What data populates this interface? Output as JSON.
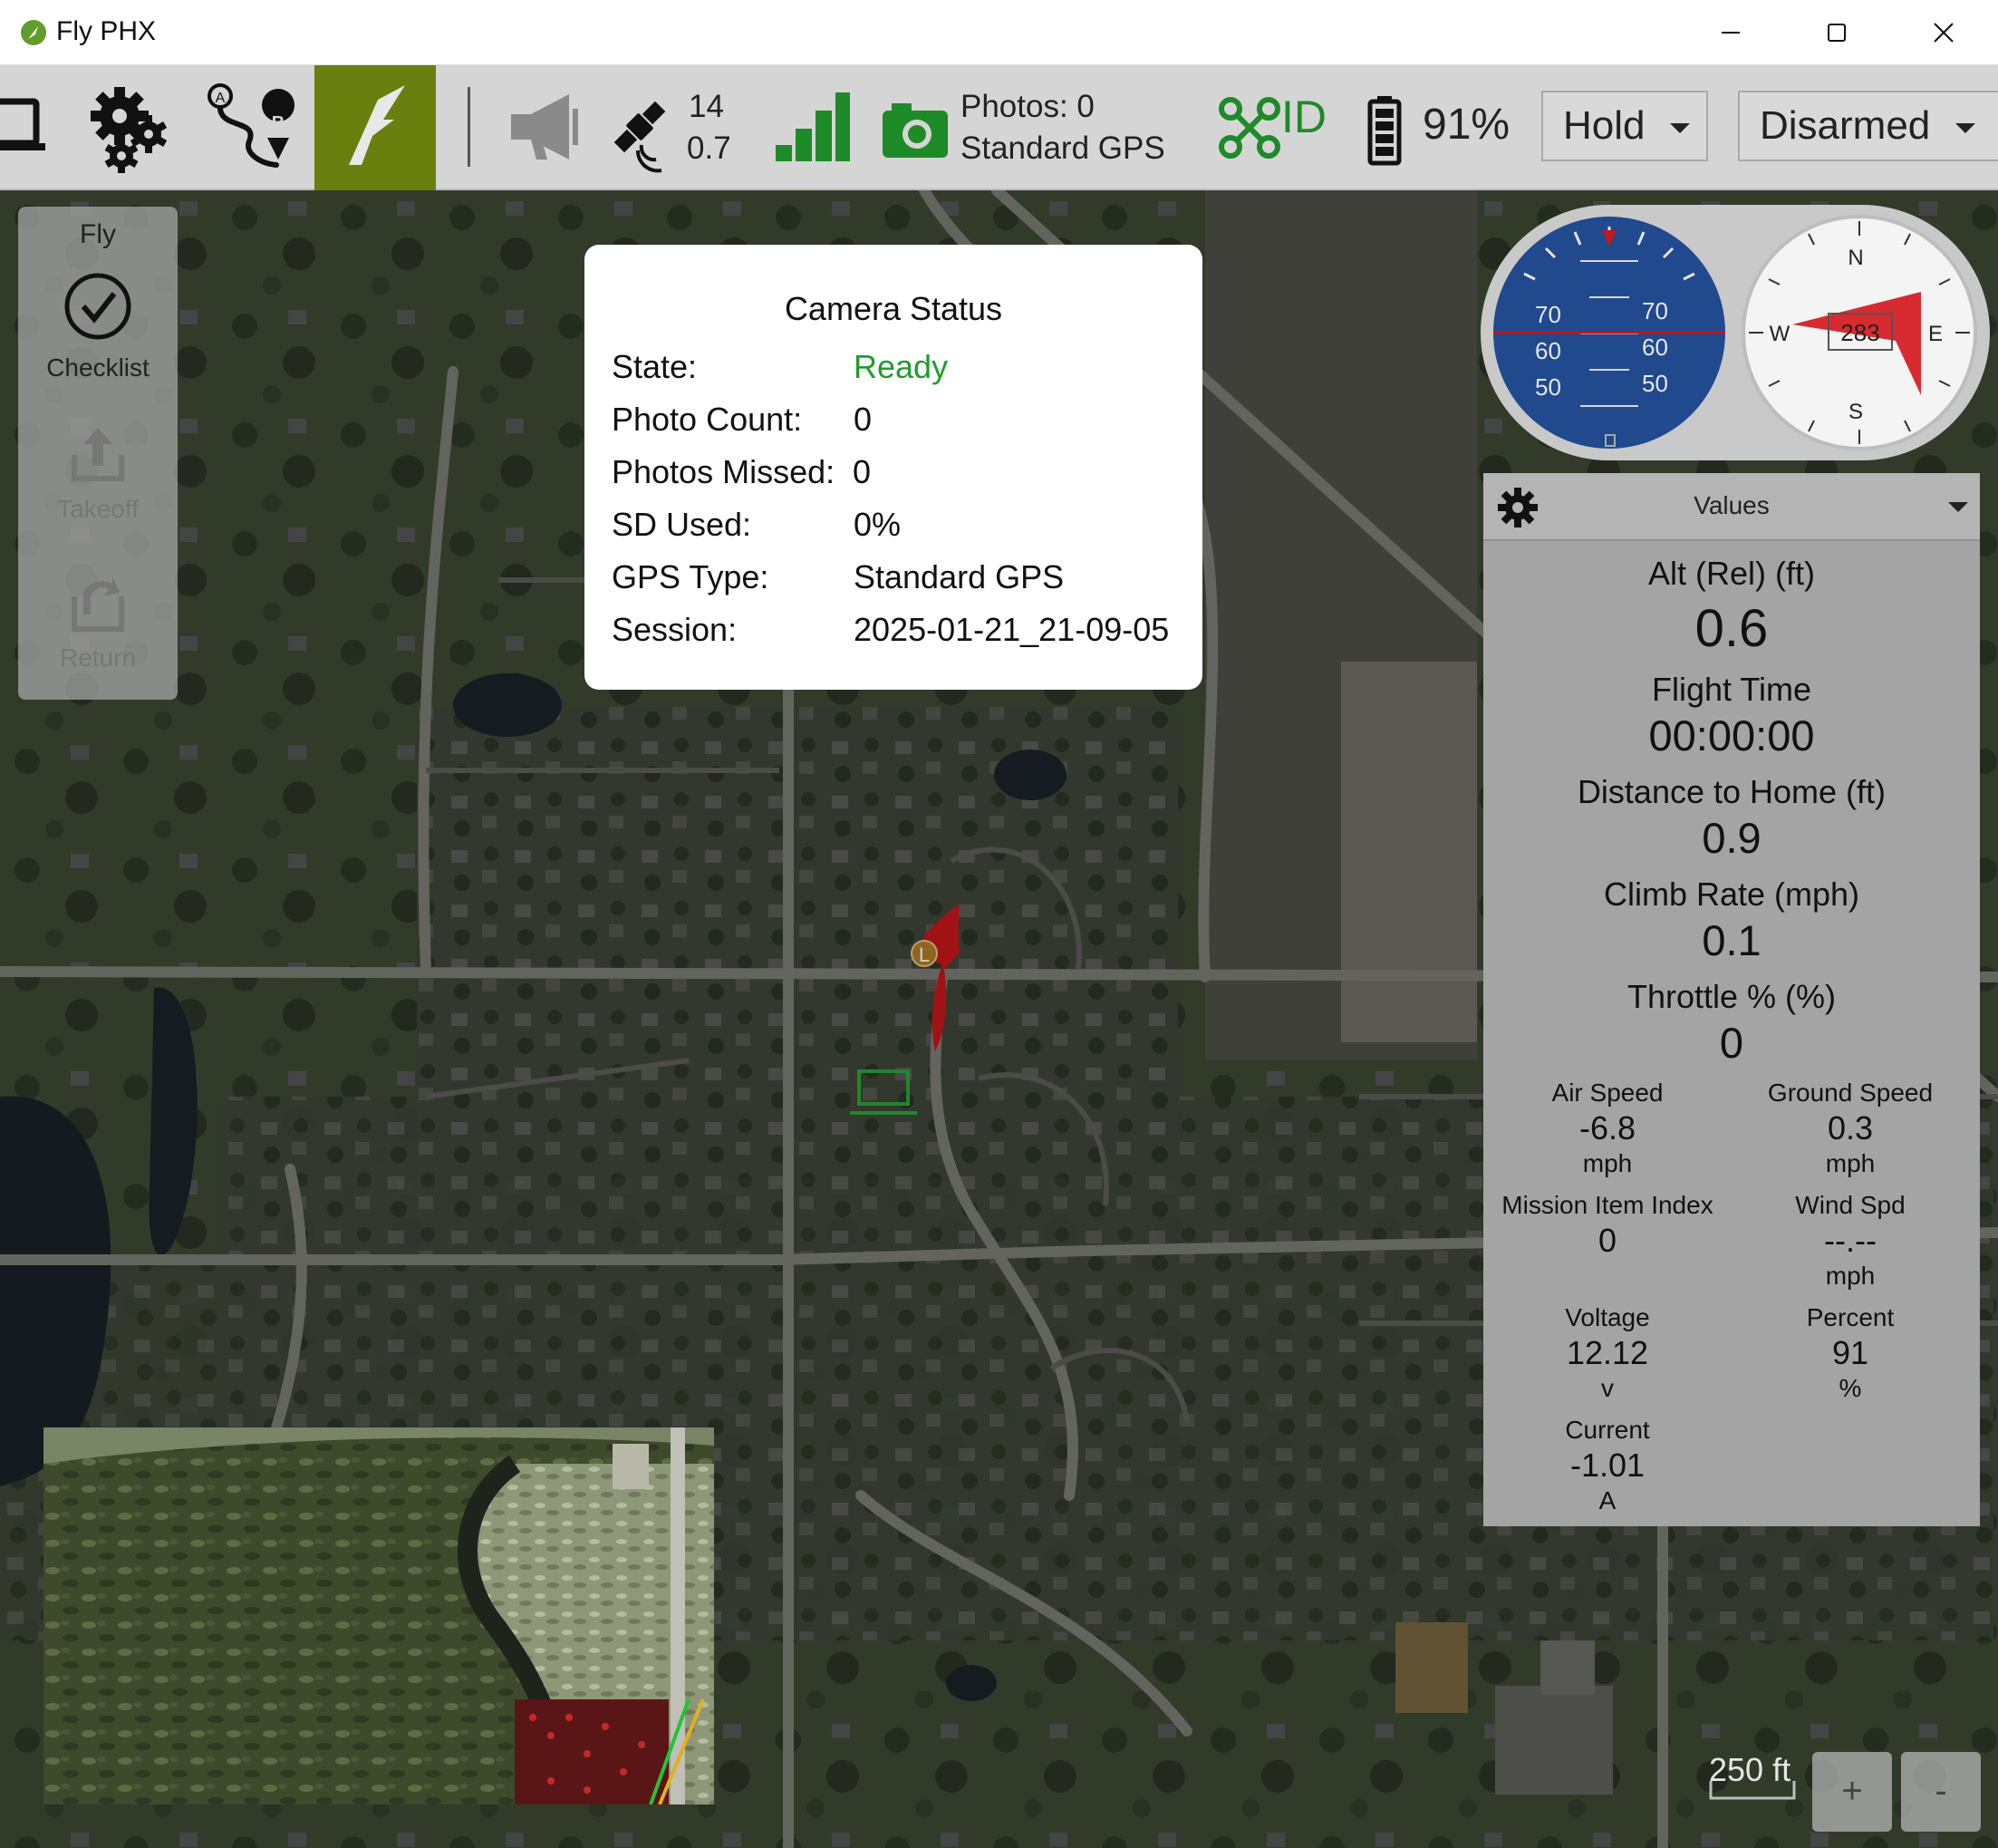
{
  "window": {
    "title": "Fly PHX",
    "controls": [
      "minimize-icon",
      "maximize-icon",
      "close-icon"
    ]
  },
  "toolbar": {
    "icons": [
      "laptop-icon",
      "gears-icon",
      "plan-route-icon",
      "fly-plane-icon",
      "megaphone-icon",
      "satellite-icon",
      "signal-bars-icon",
      "camera-icon",
      "remote-id-icon",
      "battery-icon"
    ],
    "gps_count": "14",
    "gps_hdop": "0.7",
    "photos_line1": "Photos: 0",
    "photos_line2": "Standard GPS",
    "remote_id_label": "ID",
    "battery_percent": "91%",
    "flight_mode": "Hold",
    "arm_state": "Disarmed",
    "colors": {
      "toolbar_bg": "#d5d5d5",
      "active": "#6b7f0e",
      "status_green": "#1f8a28"
    }
  },
  "fly_tools": {
    "header": "Fly",
    "items": [
      {
        "label": "Checklist",
        "icon": "checklist-icon",
        "enabled": true
      },
      {
        "label": "Takeoff",
        "icon": "takeoff-icon",
        "enabled": false
      },
      {
        "label": "Return",
        "icon": "return-icon",
        "enabled": false
      }
    ]
  },
  "camera_status": {
    "title": "Camera Status",
    "rows": [
      {
        "key": "State:",
        "value": "Ready"
      },
      {
        "key": "Photo Count:",
        "value": "0"
      },
      {
        "key": "Photos Missed:",
        "value": "0"
      },
      {
        "key": "SD Used:",
        "value": "0%"
      },
      {
        "key": "GPS Type:",
        "value": "Standard GPS"
      },
      {
        "key": "Session:",
        "value": "2025-01-21_21-09-05"
      }
    ]
  },
  "attitude": {
    "pitch_ticks": [
      "70",
      "60",
      "50"
    ]
  },
  "compass": {
    "heading": "283",
    "cardinals": {
      "n": "N",
      "e": "E",
      "s": "S",
      "w": "W"
    }
  },
  "values_panel": {
    "title": "Values",
    "big": [
      {
        "label": "Alt (Rel) (ft)",
        "value": "0.6"
      },
      {
        "label": "Flight Time",
        "value": "00:00:00"
      },
      {
        "label": "Distance to Home (ft)",
        "value": "0.9"
      },
      {
        "label": "Climb Rate (mph)",
        "value": "0.1"
      },
      {
        "label": "Throttle % (%)",
        "value": "0"
      }
    ],
    "small": [
      {
        "label": "Air Speed",
        "value": "-6.8",
        "unit": "mph"
      },
      {
        "label": "Ground Speed",
        "value": "0.3",
        "unit": "mph"
      },
      {
        "label": "Mission Item Index",
        "value": "0",
        "unit": ""
      },
      {
        "label": "Wind Spd",
        "value": "--.--",
        "unit": "mph"
      },
      {
        "label": "Voltage",
        "value": "12.12",
        "unit": "v"
      },
      {
        "label": "Percent",
        "value": "91",
        "unit": "%"
      },
      {
        "label": "Current",
        "value": "-1.01",
        "unit": "A"
      }
    ]
  },
  "map": {
    "scale_label": "250 ft",
    "zoom_in": "+",
    "zoom_out": "-",
    "home_marker": "L"
  }
}
